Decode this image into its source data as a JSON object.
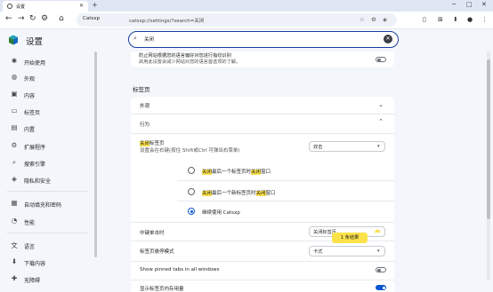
{
  "browser": {
    "tab_title": "设置",
    "site_label": "Catsxp",
    "url": "catsxp://settings/?search=关闭"
  },
  "settings": {
    "app_title": "设置",
    "search": {
      "value": "关闭"
    },
    "sidebar": [
      {
        "label": "开始使用",
        "icon": "puzzle-icon"
      },
      {
        "label": "外观",
        "icon": "palette-icon"
      },
      {
        "label": "内容",
        "icon": "content-icon"
      },
      {
        "label": "标签页",
        "icon": "tabs-icon"
      },
      {
        "label": "内置",
        "icon": "briefcase-icon"
      },
      {
        "label": "扩展程序",
        "icon": "extension-icon"
      },
      {
        "label": "搜索引擎",
        "icon": "search-icon"
      },
      {
        "label": "隐私和安全",
        "icon": "shield-icon"
      },
      {
        "label": "自动填充和密码",
        "icon": "autofill-icon"
      },
      {
        "label": "性能",
        "icon": "speedometer-icon"
      },
      {
        "label": "语言",
        "icon": "language-icon"
      },
      {
        "label": "下载内容",
        "icon": "download-icon"
      },
      {
        "label": "无障碍",
        "icon": "accessibility-icon"
      }
    ],
    "top_card": {
      "line1": "防止网站根据您的语言偏好对您进行指纹识别",
      "line2": "启用此设置会减少网站对您的语言首选项的了解。"
    },
    "section_title": "标签页",
    "rows": {
      "appearance": "外观",
      "behavior": "行为",
      "close_title_hl": "关闭",
      "close_title_rest": "标签页",
      "close_sub": "设置会在右键(按住 Shift或Ctrl 可弹出右菜单)",
      "close_select_value": "双击",
      "radio1": [
        "关闭",
        "最后一个标签页时",
        "关闭",
        "窗口"
      ],
      "radio2": [
        "关闭",
        "最后一个新标签页时",
        "关闭",
        "窗口"
      ],
      "radio3": "继续使用 Catsxp",
      "middle_click_label": "中键单击时",
      "middle_click_value": "关闭标签页",
      "hover_mode_label": "标签页悬停模式",
      "hover_mode_value": "卡式",
      "pinned_tabs_label": "Show pinned tabs in all windows",
      "memory_usage_label": "显示标签页内存用量"
    },
    "result_bubble": "1 条结果",
    "toggles": {
      "language_fingerprint": false,
      "pinned_tabs": false,
      "memory_usage": true
    },
    "radio_selected": 3
  },
  "colors": {
    "accent": "#0b57d0",
    "highlight": "#fbe24a",
    "search_border": "#1a3e9a"
  }
}
